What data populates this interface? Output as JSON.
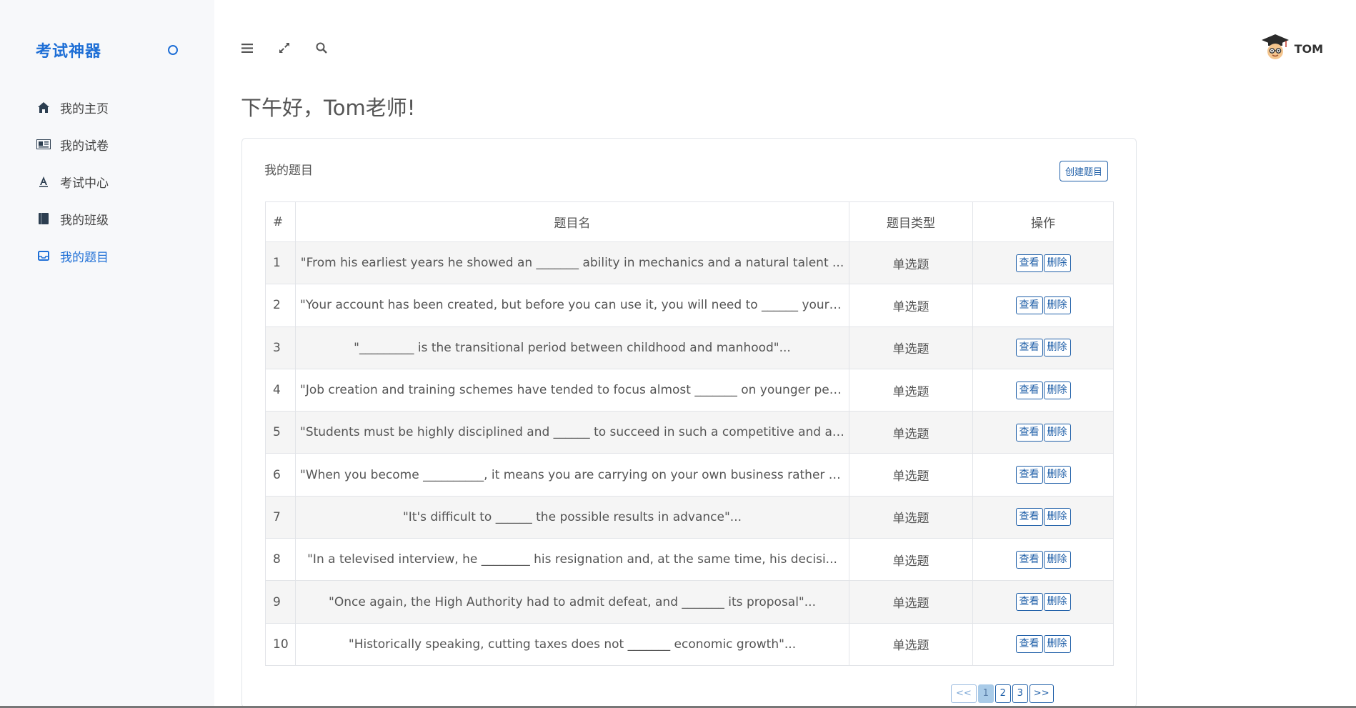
{
  "sidebar": {
    "brand": "考试神器",
    "items": [
      {
        "label": "我的主页",
        "icon": "home-icon"
      },
      {
        "label": "我的试卷",
        "icon": "newspaper-icon"
      },
      {
        "label": "考试中心",
        "icon": "font-icon"
      },
      {
        "label": "我的班级",
        "icon": "book-icon"
      },
      {
        "label": "我的题目",
        "icon": "inbox-icon",
        "active": true
      }
    ]
  },
  "header": {
    "icons": [
      "menu-icon",
      "expand-icon",
      "search-icon"
    ],
    "user": {
      "name": "TOM",
      "avatar": "graduate-avatar-icon"
    }
  },
  "greeting": "下午好，Tom老师!",
  "card": {
    "title": "我的题目",
    "create_label": "创建题目",
    "columns": [
      "#",
      "题目名",
      "题目类型",
      "操作"
    ],
    "rows": [
      {
        "num": "1",
        "name": "\"From his earliest years he showed an _______ ability in mechanics and a natural talent ...",
        "type": "单选题"
      },
      {
        "num": "2",
        "name": "\"Your account has been created, but before you can use it, you will need to ______ your a...",
        "type": "单选题"
      },
      {
        "num": "3",
        "name": "\"_________ is the transitional period between childhood and manhood\"...",
        "type": "单选题"
      },
      {
        "num": "4",
        "name": "\"Job creation and training schemes have tended to focus almost _______ on younger people...",
        "type": "单选题"
      },
      {
        "num": "5",
        "name": "\"Students must be highly disciplined and ______ to succeed in such a competitive and acti...",
        "type": "单选题"
      },
      {
        "num": "6",
        "name": "\"When you become __________, it means you are carrying on your own business rather than ...",
        "type": "单选题"
      },
      {
        "num": "7",
        "name": "\"It's difficult to ______ the possible results in advance\"...",
        "type": "单选题"
      },
      {
        "num": "8",
        "name": "\"In a televised interview, he ________ his resignation and, at the same time, his decisi...",
        "type": "单选题"
      },
      {
        "num": "9",
        "name": "\"Once again, the High Authority had to admit defeat, and _______ its proposal\"...",
        "type": "单选题"
      },
      {
        "num": "10",
        "name": "\"Historically speaking, cutting taxes does not _______ economic growth\"...",
        "type": "单选题"
      }
    ],
    "view_label": "查看",
    "delete_label": "删除"
  },
  "pagination": {
    "prev": "<<",
    "pages": [
      "1",
      "2",
      "3"
    ],
    "current": "1",
    "next": ">>"
  },
  "colors": {
    "accent": "#1f6fd6",
    "button": "#1f5fa8"
  }
}
